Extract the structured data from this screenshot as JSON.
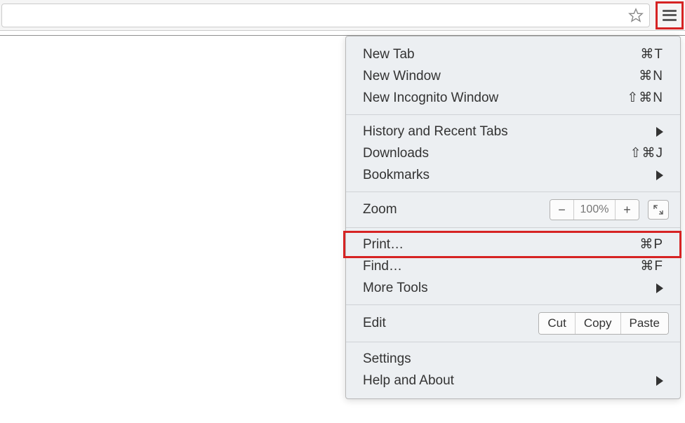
{
  "toolbar": {
    "star_icon": "star-icon",
    "menu_icon": "hamburger-icon"
  },
  "menu": {
    "section1": [
      {
        "label": "New Tab",
        "shortcut": "⌘T"
      },
      {
        "label": "New Window",
        "shortcut": "⌘N"
      },
      {
        "label": "New Incognito Window",
        "shortcut": "⇧⌘N"
      }
    ],
    "section2": [
      {
        "label": "History and Recent Tabs",
        "submenu": true
      },
      {
        "label": "Downloads",
        "shortcut": "⇧⌘J"
      },
      {
        "label": "Bookmarks",
        "submenu": true
      }
    ],
    "zoom": {
      "label": "Zoom",
      "minus": "−",
      "value": "100%",
      "plus": "+"
    },
    "section3": [
      {
        "label": "Print…",
        "shortcut": "⌘P",
        "highlight": true
      },
      {
        "label": "Find…",
        "shortcut": "⌘F"
      },
      {
        "label": "More Tools",
        "submenu": true
      }
    ],
    "edit": {
      "label": "Edit",
      "cut": "Cut",
      "copy": "Copy",
      "paste": "Paste"
    },
    "section4": [
      {
        "label": "Settings"
      },
      {
        "label": "Help and About",
        "submenu": true
      }
    ]
  }
}
